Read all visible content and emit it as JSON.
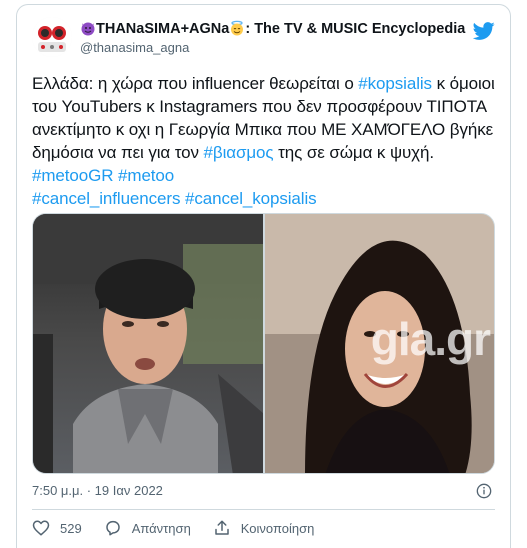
{
  "tweet": {
    "display_name_prefix": "THANaSIMA+AGNa",
    "display_name_suffix": ": The TV & MUSIC Encyclopedia",
    "handle": "@thanasima_agna",
    "text_segments": [
      {
        "text": "Ελλάδα: η χώρα που influencer θεωρείται ο ",
        "tag": false
      },
      {
        "text": "#kopsialis",
        "tag": true
      },
      {
        "text": " κ όμοιοι του YouTubers κ Instagramers που δεν προσφέρουν ΤΙΠΟΤΑ ανεκτίμητο κ οχι η Γεωργία Μπικα που ΜΕ ΧΑΜΌΓΕΛΟ βγήκε δημόσια να πει για τον ",
        "tag": false
      },
      {
        "text": "#βιασμος",
        "tag": true
      },
      {
        "text": " της σε σώμα κ ψυχή. ",
        "tag": false
      },
      {
        "text": "#metooGR",
        "tag": true
      },
      {
        "text": " ",
        "tag": false
      },
      {
        "text": "#metoo",
        "tag": true
      },
      {
        "text": " ",
        "tag": false
      },
      {
        "text": "#cancel_influencers",
        "tag": true
      },
      {
        "text": " ",
        "tag": false
      },
      {
        "text": "#cancel_kopsialis",
        "tag": true
      }
    ],
    "media_watermark": "gla.gr",
    "timestamp": "7:50 μ.μ. · 19 Ιαν 2022",
    "likes_count": "529",
    "reply_label": "Απάντηση",
    "share_label": "Κοινοποίηση"
  },
  "icons": {
    "brand": "twitter-bird-icon",
    "like": "heart-icon",
    "reply": "reply-bubble-icon",
    "share": "share-icon",
    "info": "info-icon"
  },
  "colors": {
    "accent": "#1d9bf0",
    "text": "#0f1419",
    "secondary_text": "#536471",
    "border": "#cfd9de"
  }
}
